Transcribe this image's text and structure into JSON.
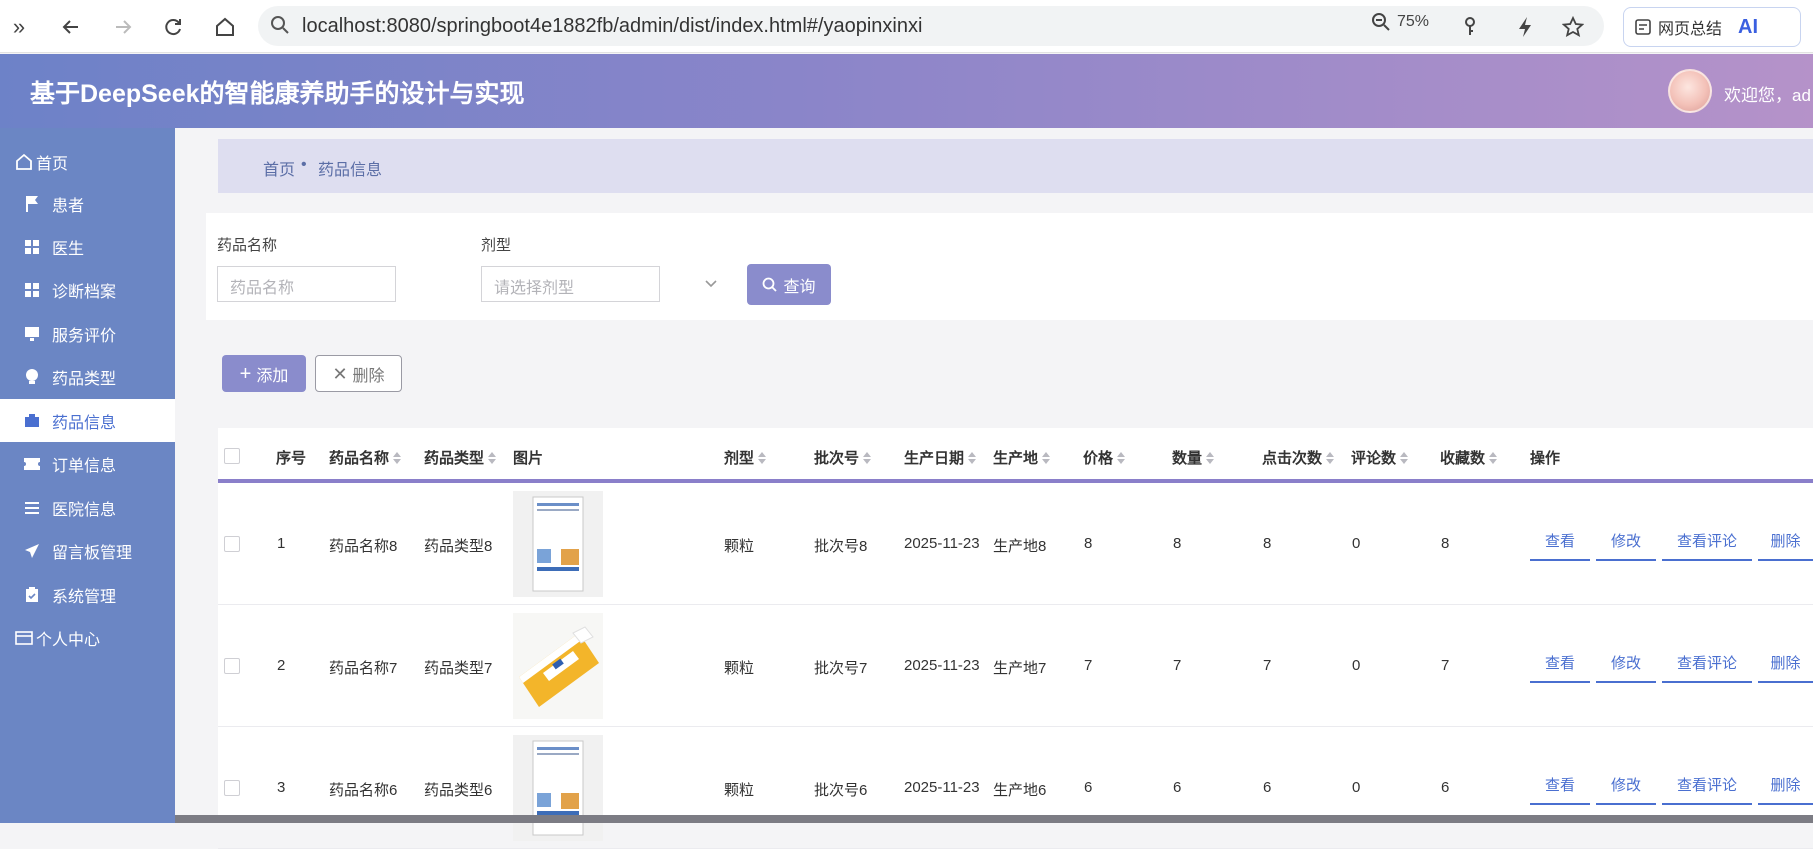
{
  "browser": {
    "url": "localhost:8080/springboot4e1882fb/admin/dist/index.html#/yaopinxinxi",
    "zoom": "75%",
    "summary_label": "网页总结",
    "ai_label": "AI"
  },
  "app": {
    "title": "基于DeepSeek的智能康养助手的设计与实现",
    "welcome": "欢迎您，ad"
  },
  "sidebar": {
    "items": [
      {
        "label": "首页",
        "icon": "home-icon"
      },
      {
        "label": "患者",
        "icon": "flag-icon"
      },
      {
        "label": "医生",
        "icon": "grid-icon"
      },
      {
        "label": "诊断档案",
        "icon": "grid-icon"
      },
      {
        "label": "服务评价",
        "icon": "monitor-icon"
      },
      {
        "label": "药品类型",
        "icon": "bulb-icon"
      },
      {
        "label": "药品信息",
        "icon": "briefcase-icon",
        "active": true
      },
      {
        "label": "订单信息",
        "icon": "ticket-icon"
      },
      {
        "label": "医院信息",
        "icon": "list-icon"
      },
      {
        "label": "留言板管理",
        "icon": "send-icon"
      },
      {
        "label": "系统管理",
        "icon": "clipboard-icon"
      },
      {
        "label": "个人中心",
        "icon": "card-icon"
      }
    ]
  },
  "breadcrumb": {
    "home": "首页",
    "sep": "•",
    "current": "药品信息"
  },
  "filter": {
    "name_label": "药品名称",
    "name_placeholder": "药品名称",
    "form_label": "剂型",
    "form_placeholder": "请选择剂型",
    "query_label": "查询"
  },
  "toolbar": {
    "add_label": "添加",
    "delete_label": "删除"
  },
  "table": {
    "headers": [
      "序号",
      "药品名称",
      "药品类型",
      "图片",
      "剂型",
      "批次号",
      "生产日期",
      "生产地",
      "价格",
      "数量",
      "点击次数",
      "评论数",
      "收藏数",
      "操作"
    ],
    "actions": [
      "查看",
      "修改",
      "查看评论",
      "删除"
    ],
    "rows": [
      {
        "index": "1",
        "name": "药品名称8",
        "type": "药品类型8",
        "form": "颗粒",
        "batch": "批次号8",
        "date": "2025-11-23",
        "origin": "生产地8",
        "price": "8",
        "qty": "8",
        "clicks": "8",
        "comments": "0",
        "favs": "8",
        "image": "white-box"
      },
      {
        "index": "2",
        "name": "药品名称7",
        "type": "药品类型7",
        "form": "颗粒",
        "batch": "批次号7",
        "date": "2025-11-23",
        "origin": "生产地7",
        "price": "7",
        "qty": "7",
        "clicks": "7",
        "comments": "0",
        "favs": "7",
        "image": "yellow-box"
      },
      {
        "index": "3",
        "name": "药品名称6",
        "type": "药品类型6",
        "form": "颗粒",
        "batch": "批次号6",
        "date": "2025-11-23",
        "origin": "生产地6",
        "price": "6",
        "qty": "6",
        "clicks": "6",
        "comments": "0",
        "favs": "6",
        "image": "white-box"
      }
    ]
  },
  "colors": {
    "header_start": "#6d82c8",
    "header_end": "#b592c9",
    "sidebar": "#6b86c4",
    "accent": "#8a8ccc",
    "link": "#4a6fd0"
  }
}
